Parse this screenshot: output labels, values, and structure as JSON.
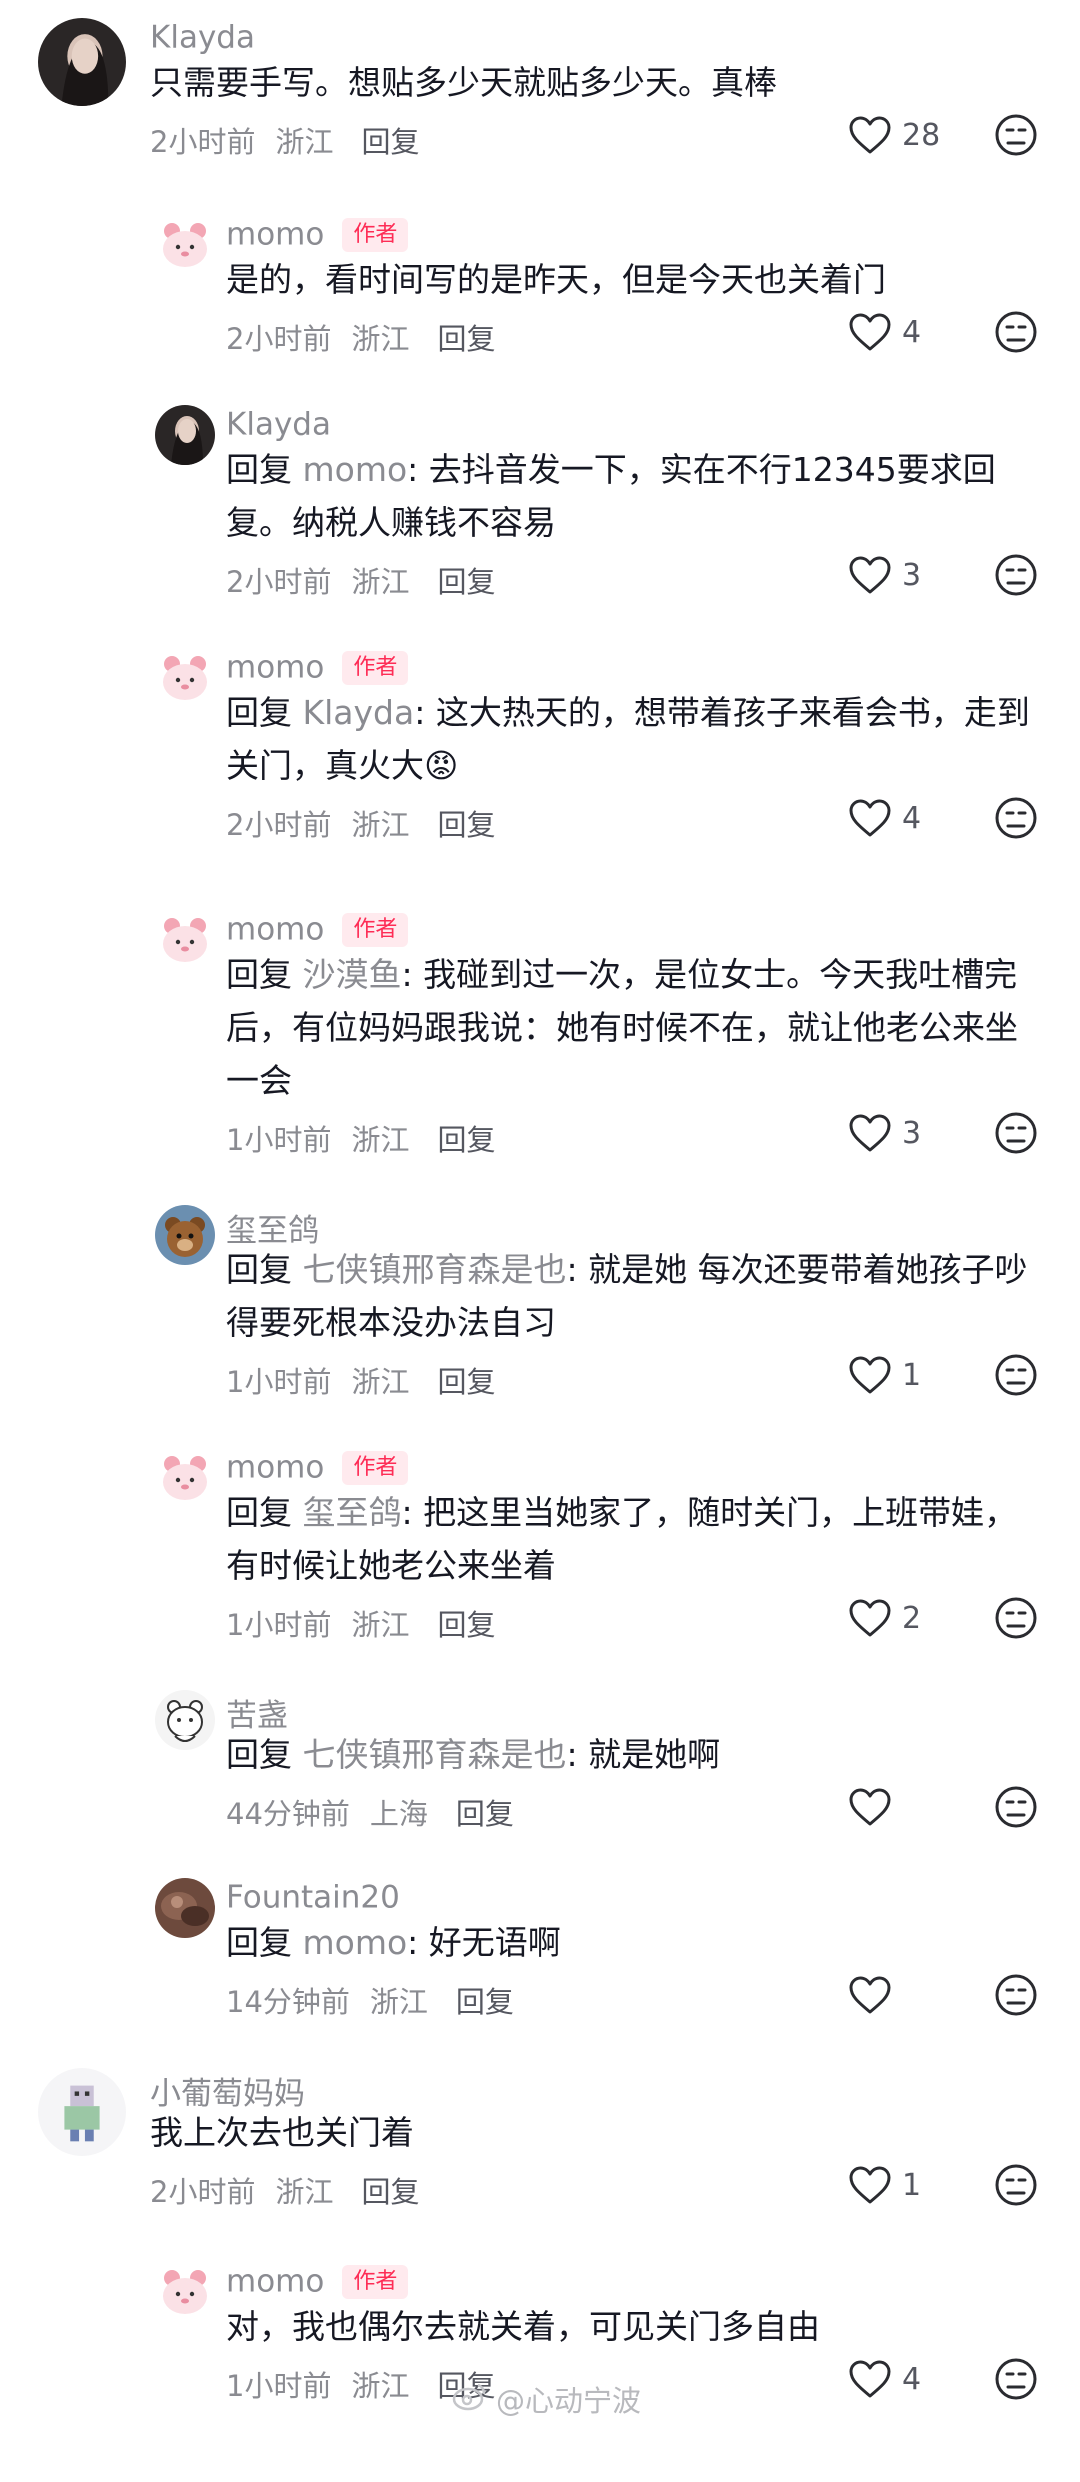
{
  "comments": [
    {
      "id": "c1",
      "level": "top",
      "name": "Klayda",
      "author": false,
      "avatar": "dark-portrait",
      "text": "只需要手写。想贴多少天就贴多少天。真棒",
      "time": "2小时前",
      "location": "浙江",
      "reply": "回复",
      "likes": "28"
    },
    {
      "id": "c2",
      "level": "reply",
      "name": "momo",
      "author": true,
      "badge": "作者",
      "avatar": "pink-bear",
      "text": "是的，看时间写的是昨天，但是今天也关着门",
      "time": "2小时前",
      "location": "浙江",
      "reply": "回复",
      "likes": "4"
    },
    {
      "id": "c3",
      "level": "reply",
      "name": "Klayda",
      "author": false,
      "avatar": "dark-portrait",
      "reply_prefix": "回复",
      "reply_to": "momo",
      "text_after": ": 去抖音发一下，实在不行12345要求回复。纳税人赚钱不容易",
      "time": "2小时前",
      "location": "浙江",
      "reply": "回复",
      "likes": "3"
    },
    {
      "id": "c4",
      "level": "reply",
      "name": "momo",
      "author": true,
      "badge": "作者",
      "avatar": "pink-bear",
      "reply_prefix": "回复",
      "reply_to": "Klayda",
      "text_after": ": 这大热天的，想带着孩子来看会书，走到关门，真火大😡",
      "time": "2小时前",
      "location": "浙江",
      "reply": "回复",
      "likes": "4"
    },
    {
      "id": "c5",
      "level": "reply",
      "name": "momo",
      "author": true,
      "badge": "作者",
      "avatar": "pink-bear",
      "reply_prefix": "回复",
      "reply_to": "沙漠鱼",
      "text_after": ": 我碰到过一次，是位女士。今天我吐槽完后，有位妈妈跟我说：她有时候不在，就让他老公来坐一会",
      "time": "1小时前",
      "location": "浙江",
      "reply": "回复",
      "likes": "3"
    },
    {
      "id": "c6",
      "level": "reply",
      "name": "玺至鸽",
      "author": false,
      "avatar": "teddy-bear",
      "reply_prefix": "回复",
      "reply_to": "七侠镇邢育森是也",
      "text_after": ": 就是她 每次还要带着她孩子吵得要死根本没办法自习",
      "time": "1小时前",
      "location": "浙江",
      "reply": "回复",
      "likes": "1"
    },
    {
      "id": "c7",
      "level": "reply",
      "name": "momo",
      "author": true,
      "badge": "作者",
      "avatar": "pink-bear",
      "reply_prefix": "回复",
      "reply_to": "玺至鸽",
      "text_after": ": 把这里当她家了，随时关门，上班带娃，有时候让她老公来坐着",
      "time": "1小时前",
      "location": "浙江",
      "reply": "回复",
      "likes": "2"
    },
    {
      "id": "c8",
      "level": "reply",
      "name": "苦盏",
      "author": false,
      "avatar": "white-bear",
      "reply_prefix": "回复",
      "reply_to": "七侠镇邢育森是也",
      "text_after": ": 就是她啊",
      "time": "44分钟前",
      "location": "上海",
      "reply": "回复",
      "likes": ""
    },
    {
      "id": "c9",
      "level": "reply",
      "name": "Fountain20",
      "author": false,
      "avatar": "brown-photo",
      "reply_prefix": "回复",
      "reply_to": "momo",
      "text_after": ": 好无语啊",
      "time": "14分钟前",
      "location": "浙江",
      "reply": "回复",
      "likes": ""
    },
    {
      "id": "c10",
      "level": "top",
      "name": "小葡萄妈妈",
      "author": false,
      "avatar": "pixel-figure",
      "text": "我上次去也关门着",
      "time": "2小时前",
      "location": "浙江",
      "reply": "回复",
      "likes": "1"
    },
    {
      "id": "c11",
      "level": "reply",
      "name": "momo",
      "author": true,
      "badge": "作者",
      "avatar": "pink-bear",
      "text": "对，我也偶尔去就关着，可见关门多自由",
      "time": "1小时前",
      "location": "浙江",
      "reply": "回复",
      "likes": "4"
    }
  ],
  "watermark": {
    "text": "@心动宁波",
    "icon": "weibo-icon"
  },
  "colors": {
    "author_badge": "#fe2c55",
    "author_badge_bg": "#ffeaee",
    "muted": "#8a8b91",
    "text": "#161823"
  }
}
